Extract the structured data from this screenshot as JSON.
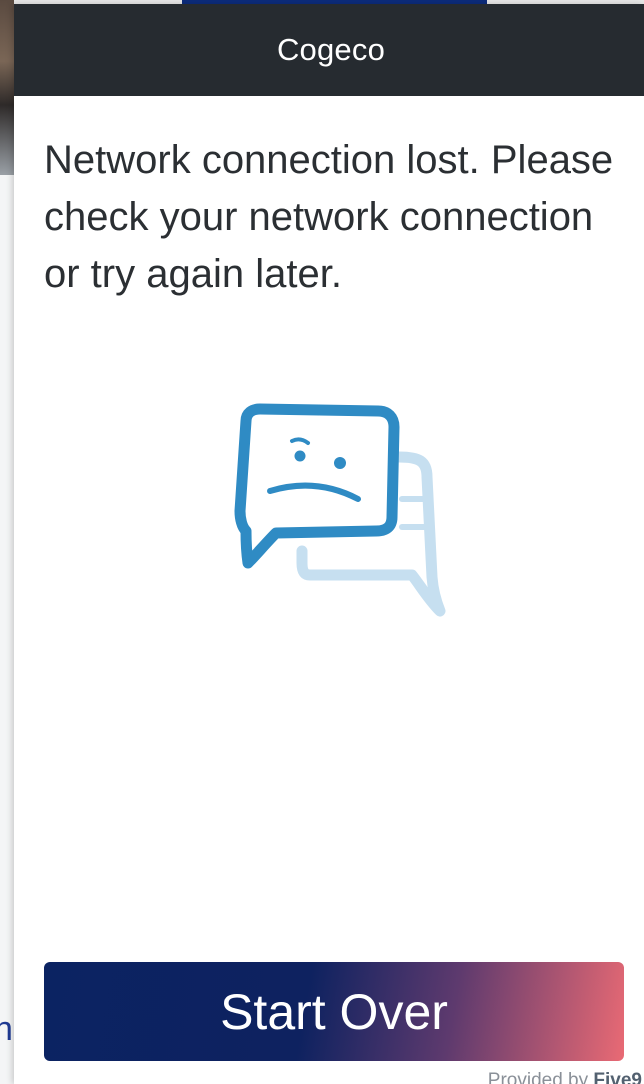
{
  "header": {
    "title": "Cogeco"
  },
  "main": {
    "message": "Network connection lost. Please check your network connection or try again later.",
    "illustration_icon": "sad-chat-bubbles-icon",
    "start_over_label": "Start Over"
  },
  "footer": {
    "provided_by": "Provided by",
    "brand": "Five9"
  },
  "background": {
    "partial_text": "n"
  },
  "colors": {
    "header_bg": "#262b30",
    "icon_primary": "#2f8bc4",
    "icon_secondary": "#c6dff0",
    "button_gradient_start": "#0b2362",
    "button_gradient_end": "#e96a74"
  }
}
